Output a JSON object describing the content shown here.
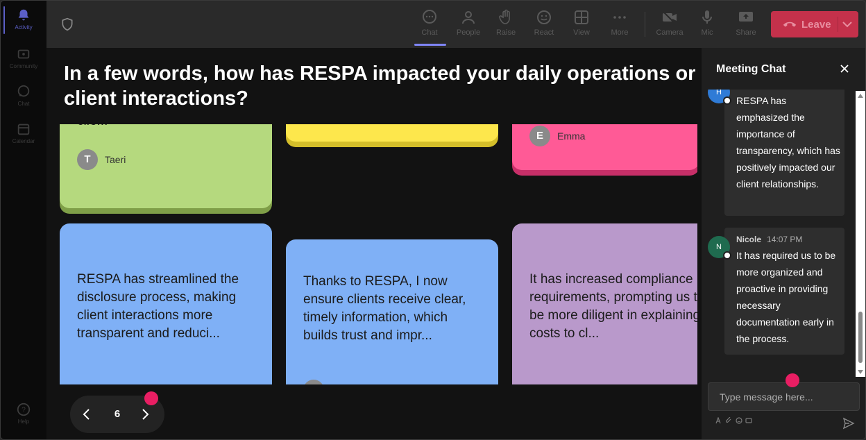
{
  "rail": {
    "items": [
      {
        "label": "Activity",
        "icon": "bell-icon"
      },
      {
        "label": "Community",
        "icon": "community-icon"
      },
      {
        "label": "Chat",
        "icon": "chat-icon"
      },
      {
        "label": "Calendar",
        "icon": "calendar-icon"
      },
      {
        "label": "Help",
        "icon": "help-icon"
      }
    ]
  },
  "toolbar": {
    "chat": "Chat",
    "people": "People",
    "raise": "Raise",
    "react": "React",
    "view": "View",
    "more": "More",
    "camera": "Camera",
    "mic": "Mic",
    "share": "Share",
    "leave": "Leave"
  },
  "stage": {
    "question": "In a few words, how has RESPA impacted your daily operations or client interactions?",
    "notes": [
      {
        "color": "#b5d97e",
        "shadow": "#7f9f48",
        "text": "clie...",
        "author": "Taeri",
        "initial": "T"
      },
      {
        "color": "#fde74c",
        "shadow": "#d4be2a",
        "text": "",
        "author": "",
        "initial": ""
      },
      {
        "color": "#ff5a96",
        "shadow": "#c72f68",
        "text": "",
        "author": "Emma",
        "initial": "E"
      },
      {
        "color": "#7fb0f6",
        "shadow": "#5a88cc",
        "text": "RESPA has streamlined the disclosure process, making client interactions more transparent and reduci...",
        "author": "",
        "initial": ""
      },
      {
        "color": "#7fb0f6",
        "shadow": "#5a88cc",
        "text": "Thanks to RESPA, I now ensure clients receive clear, timely information, which builds trust and impr...",
        "author": "",
        "initial": ""
      },
      {
        "color": "#b999cb",
        "shadow": "#8f6fa3",
        "text": "It has increased compliance requirements, prompting us to be more diligent in explaining costs to cl...",
        "author": "",
        "initial": ""
      }
    ],
    "page": "6",
    "accent": "#e91e63"
  },
  "chat": {
    "title": "Meeting Chat",
    "messages": [
      {
        "sender": "",
        "time": "",
        "initial": "H",
        "avatar_color": "#2f7bd6",
        "text": "RESPA has emphasized the importance of transparency, which has positively impacted our client relationships."
      },
      {
        "sender": "Nicole",
        "time": "14:07 PM",
        "initial": "N",
        "avatar_color": "#1f6b4f",
        "text": "It has required us to be more organized and proactive in providing necessary documentation early in the process."
      }
    ],
    "placeholder": "Type message here..."
  }
}
